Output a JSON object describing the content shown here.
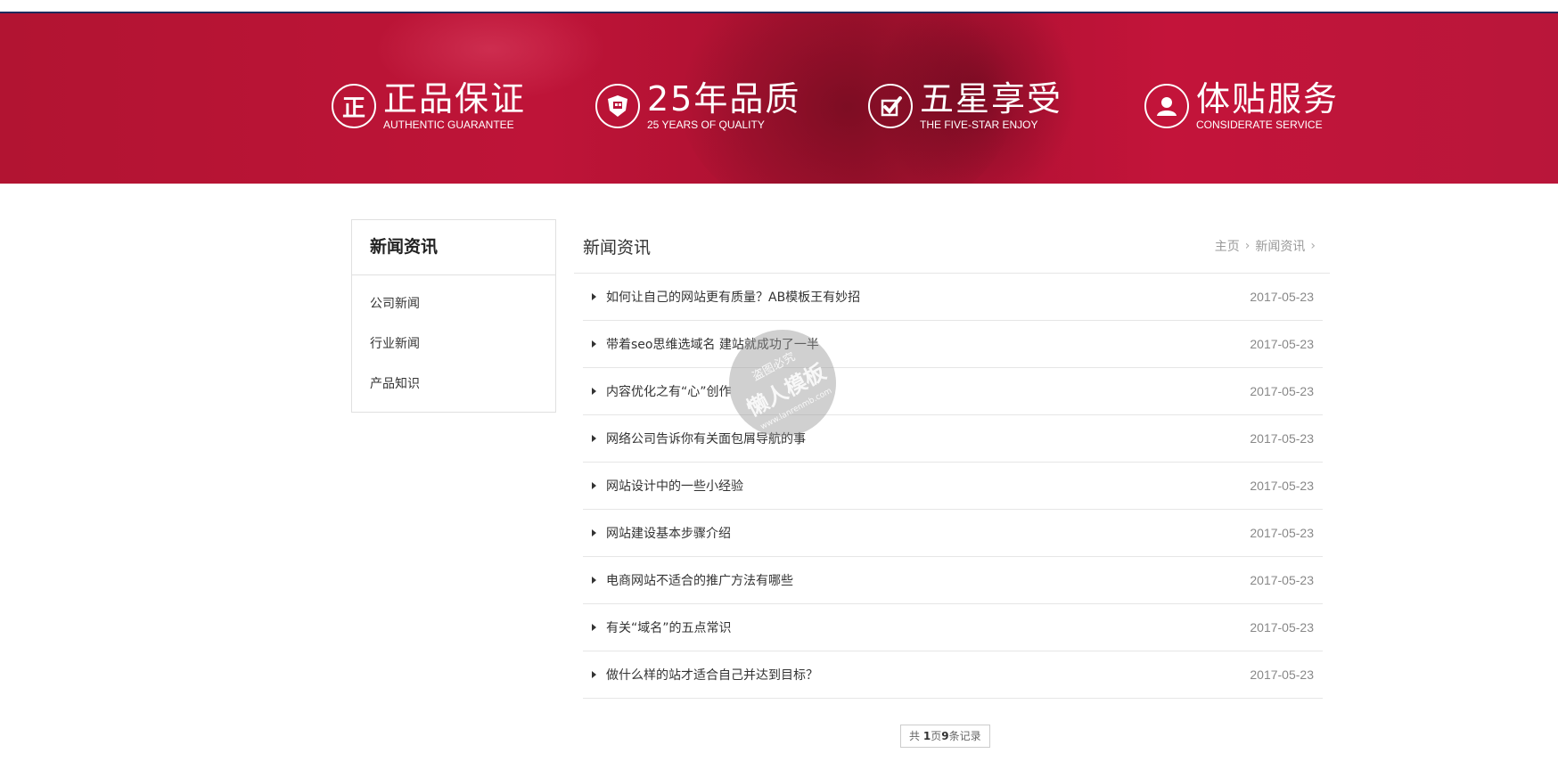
{
  "banner": {
    "features": [
      {
        "icon": "zheng-badge-icon",
        "icon_text": "正",
        "title": "正品保证",
        "subtitle": "AUTHENTIC GUARANTEE"
      },
      {
        "icon": "shield-quality-icon",
        "title": "25年品质",
        "subtitle": "25 YEARS OF QUALITY"
      },
      {
        "icon": "check-icon",
        "title": "五星享受",
        "subtitle": "THE FIVE-STAR ENJOY"
      },
      {
        "icon": "user-icon",
        "title": "体贴服务",
        "subtitle": "CONSIDERATE SERVICE"
      }
    ]
  },
  "sidebar": {
    "title": "新闻资讯",
    "items": [
      {
        "label": "公司新闻"
      },
      {
        "label": "行业新闻"
      },
      {
        "label": "产品知识"
      }
    ]
  },
  "main": {
    "title": "新闻资讯",
    "breadcrumb": {
      "home": "主页",
      "current": "新闻资讯"
    },
    "news": [
      {
        "title": "如何让自己的网站更有质量？AB模板王有妙招",
        "date": "2017-05-23"
      },
      {
        "title": "带着seo思维选域名 建站就成功了一半",
        "date": "2017-05-23"
      },
      {
        "title": "内容优化之有“心”创作",
        "date": "2017-05-23"
      },
      {
        "title": "网络公司告诉你有关面包屑导航的事",
        "date": "2017-05-23"
      },
      {
        "title": "网站设计中的一些小经验",
        "date": "2017-05-23"
      },
      {
        "title": "网站建设基本步骤介绍",
        "date": "2017-05-23"
      },
      {
        "title": "电商网站不适合的推广方法有哪些",
        "date": "2017-05-23"
      },
      {
        "title": "有关“域名”的五点常识",
        "date": "2017-05-23"
      },
      {
        "title": "做什么样的站才适合自己并达到目标？",
        "date": "2017-05-23"
      }
    ],
    "pager": {
      "prefix": "共 ",
      "pages": "1",
      "mid": "页",
      "records": "9",
      "suffix": "条记录"
    }
  },
  "watermark": {
    "line1": "盗图必究",
    "line2": "懒人模板",
    "line3": "www.lanrenmb.com"
  },
  "colors": {
    "banner_red": "#b8143a",
    "nav_line": "#1f2a5c"
  }
}
